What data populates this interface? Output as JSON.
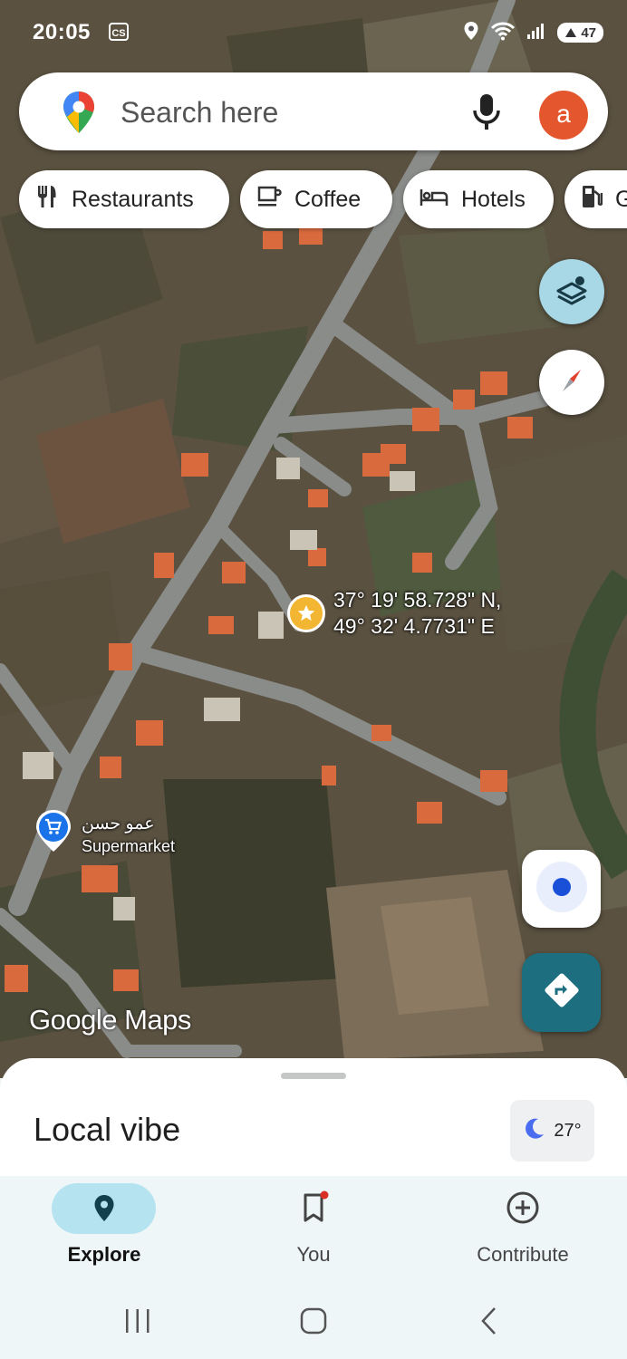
{
  "status_bar": {
    "time": "20:05",
    "carrier_badge": "CS",
    "battery": "47",
    "icons": [
      "location-icon",
      "wifi-icon",
      "signal-icon",
      "battery-icon"
    ]
  },
  "search": {
    "placeholder": "Search here",
    "avatar_letter": "a",
    "avatar_color": "#e4572e"
  },
  "chips": [
    {
      "label": "Restaurants",
      "icon": "fork-knife-icon"
    },
    {
      "label": "Coffee",
      "icon": "coffee-cup-icon"
    },
    {
      "label": "Hotels",
      "icon": "bed-icon"
    },
    {
      "label": "G",
      "icon": "gas-pump-icon"
    }
  ],
  "map": {
    "pin_coordinates": {
      "lat": "37° 19' 58.728\" N,",
      "lon": "49° 32' 4.7731\" E"
    },
    "poi": {
      "name": "عمو حسن",
      "category": "Supermarket"
    },
    "brand": "Google Maps"
  },
  "sheet": {
    "title": "Local vibe",
    "temperature": "27°"
  },
  "bottom_nav": [
    {
      "label": "Explore",
      "icon": "explore-pin-icon",
      "active": true
    },
    {
      "label": "You",
      "icon": "bookmark-icon",
      "active": false
    },
    {
      "label": "Contribute",
      "icon": "add-circle-icon",
      "active": false
    }
  ],
  "colors": {
    "accent": "#1d6e7e",
    "active_pill": "#b5e3ef",
    "nav_bg": "#eef6f8"
  }
}
